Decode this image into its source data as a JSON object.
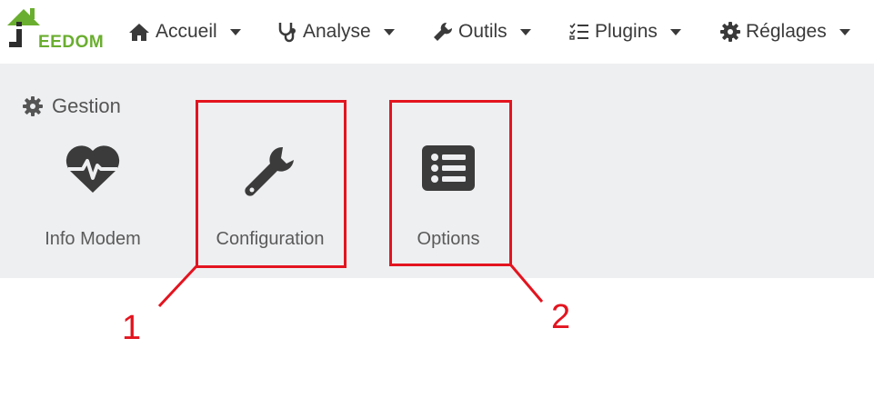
{
  "app": {
    "logo_text": "EEDOM",
    "brand_color": "#6aae2f"
  },
  "nav": [
    {
      "label": "Accueil",
      "icon": "home-icon"
    },
    {
      "label": "Analyse",
      "icon": "stethoscope-icon"
    },
    {
      "label": "Outils",
      "icon": "wrench-icon"
    },
    {
      "label": "Plugins",
      "icon": "tasks-icon"
    },
    {
      "label": "Réglages",
      "icon": "cog-icon"
    }
  ],
  "gestion": {
    "title": "Gestion",
    "title_icon": "cog-icon",
    "cards": [
      {
        "label": "Info Modem",
        "icon": "heartbeat-icon"
      },
      {
        "label": "Configuration",
        "icon": "wrench-icon"
      },
      {
        "label": "Options",
        "icon": "list-icon"
      }
    ]
  },
  "annotations": {
    "color": "#e3141f",
    "labels": [
      "1",
      "2"
    ]
  }
}
